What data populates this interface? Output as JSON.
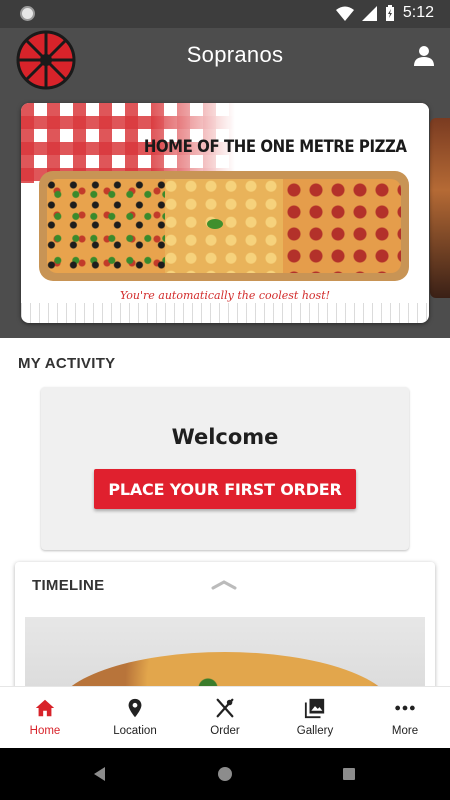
{
  "status_bar": {
    "time": "5:12"
  },
  "header": {
    "title": "Sopranos"
  },
  "banner": {
    "headline": "HOME OF THE ONE METRE PIZZA",
    "tagline": "You're automatically the coolest host!"
  },
  "activity": {
    "section_label": "MY ACTIVITY",
    "welcome": "Welcome",
    "order_button": "PLACE YOUR FIRST ORDER"
  },
  "timeline": {
    "title": "TIMELINE"
  },
  "bottom_nav": {
    "items": [
      {
        "label": "Home",
        "icon": "home-icon",
        "active": true
      },
      {
        "label": "Location",
        "icon": "location-pin-icon",
        "active": false
      },
      {
        "label": "Order",
        "icon": "utensils-icon",
        "active": false
      },
      {
        "label": "Gallery",
        "icon": "gallery-icon",
        "active": false
      },
      {
        "label": "More",
        "icon": "more-icon",
        "active": false
      }
    ]
  },
  "colors": {
    "accent": "#d8232a",
    "header_bg": "#4d4d4d",
    "button_bg": "#e0202e"
  }
}
